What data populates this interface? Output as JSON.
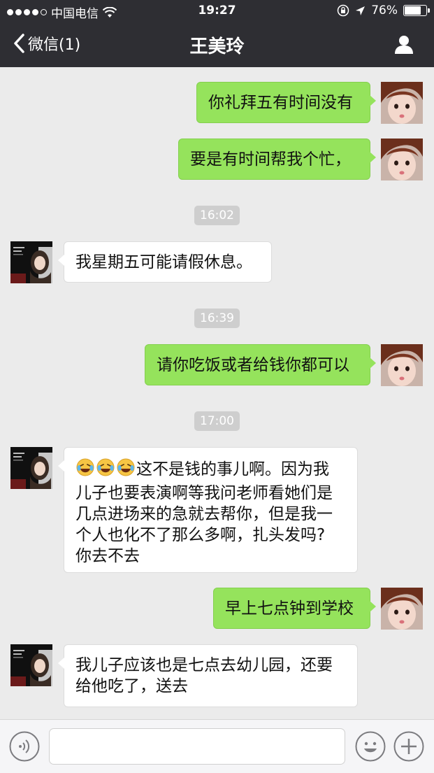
{
  "status": {
    "carrier": "中国电信",
    "time": "19:27",
    "battery": "76%",
    "battery_level": 0.76
  },
  "nav": {
    "back_label": "微信(1)",
    "title": "王美玲"
  },
  "timestamps": [
    "16:02",
    "16:39",
    "17:00"
  ],
  "messages": [
    {
      "side": "right",
      "text": "你礼拜五有时间没有"
    },
    {
      "side": "right",
      "text": "要是有时间帮我个忙，"
    },
    {
      "side": "left",
      "text": "我星期五可能请假休息。"
    },
    {
      "side": "right",
      "text": "请你吃饭或者给钱你都可以"
    },
    {
      "side": "left",
      "text_lines": [
        "这不是钱的事儿啊。因为我",
        "儿子也要表演啊等我问老师看她们是",
        "几点进场来的急就去帮你，但是我一",
        "个人也化不了那么多啊，扎头发吗?",
        "你去不去"
      ],
      "emoji": [
        "face-with-tears-of-joy",
        "face-with-tears-of-joy",
        "face-with-tears-of-joy"
      ]
    },
    {
      "side": "right",
      "text": "早上七点钟到学校"
    },
    {
      "side": "left",
      "text_lines": [
        "我儿子应该也是七点去幼儿园，还要",
        "给他吃了，送去"
      ]
    }
  ],
  "colors": {
    "nav_bg": "#2e2e33",
    "chat_bg": "#ebebeb",
    "sent_bubble": "#95e35c",
    "received_bubble": "#ffffff"
  },
  "icons": {
    "signal": "signal-dots-icon",
    "wifi": "wifi-icon",
    "orientation_lock": "orientation-lock-icon",
    "location": "location-arrow-icon",
    "back": "chevron-left-icon",
    "profile": "person-icon",
    "voice": "voice-icon",
    "emoji": "smiley-icon",
    "more": "plus-icon"
  }
}
